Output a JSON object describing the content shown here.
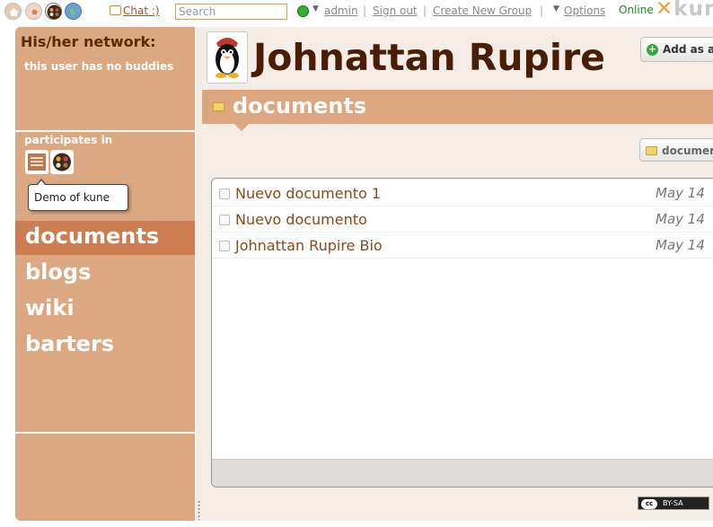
{
  "topbar": {
    "icons": [
      "home-icon",
      "personal-space-icon",
      "group-dots-icon",
      "world-icon"
    ],
    "chat_label": "Chat :)",
    "search_placeholder": "Search",
    "status_color": "#2fb02f",
    "user_label": "admin",
    "sign_out_label": "Sign out",
    "create_group_label": "Create New Group",
    "options_label": "Options",
    "online_label": "Online",
    "logo_text": "kun"
  },
  "sidebar": {
    "network_title": "His/her network:",
    "no_buddies_text": "this user has no buddies",
    "participates_label": "participates in",
    "groups": [
      "group-logo-1",
      "group-logo-2"
    ],
    "tooltip_text": "Demo of kune",
    "tools": [
      {
        "label": "documents",
        "active": true
      },
      {
        "label": "blogs",
        "active": false
      },
      {
        "label": "wiki",
        "active": false
      },
      {
        "label": "barters",
        "active": false
      }
    ]
  },
  "main": {
    "owner_name": "Johnattan Rupire",
    "add_button_label": "Add as a b",
    "section_title": "documents",
    "folder_button_label": "documents",
    "documents": [
      {
        "title": "Nuevo documento 1",
        "date": "May 14"
      },
      {
        "title": "Nuevo documento",
        "date": "May 14"
      },
      {
        "title": "Johnattan Rupire Bio",
        "date": "May 14"
      }
    ],
    "license_label": "BY-SA",
    "license_cc": "cc"
  },
  "colors": {
    "sidebar_bg": "#dca882",
    "active_tool": "#cc7e52",
    "title_text": "#4a1e05",
    "doc_link": "#8a4a18",
    "online_green": "#1a8f1a"
  }
}
